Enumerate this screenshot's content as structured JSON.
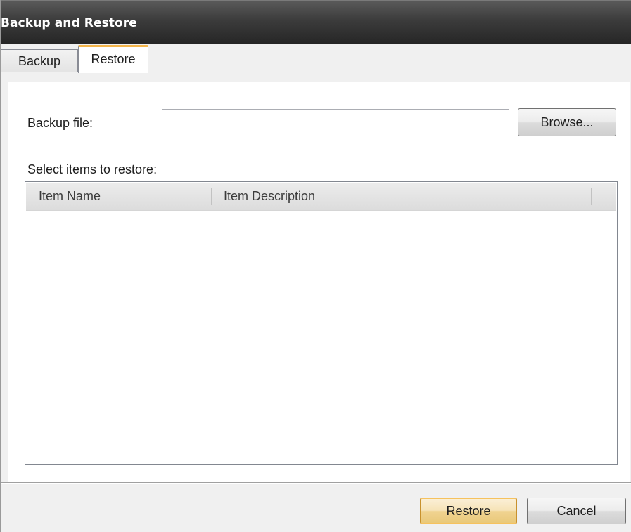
{
  "window": {
    "title": "Backup and Restore"
  },
  "tabs": [
    {
      "label": "Backup",
      "selected": false
    },
    {
      "label": "Restore",
      "selected": true
    }
  ],
  "restore": {
    "backup_file_label": "Backup file:",
    "backup_file_value": "",
    "browse_label": "Browse...",
    "select_items_label": "Select items to restore:",
    "columns": [
      "Item Name",
      "Item Description"
    ],
    "rows": []
  },
  "footer": {
    "restore_label": "Restore",
    "cancel_label": "Cancel"
  },
  "colors": {
    "titlebar": "#3c3c3c",
    "tab_accent": "#f4b54a",
    "default_button": "#f0d391"
  }
}
